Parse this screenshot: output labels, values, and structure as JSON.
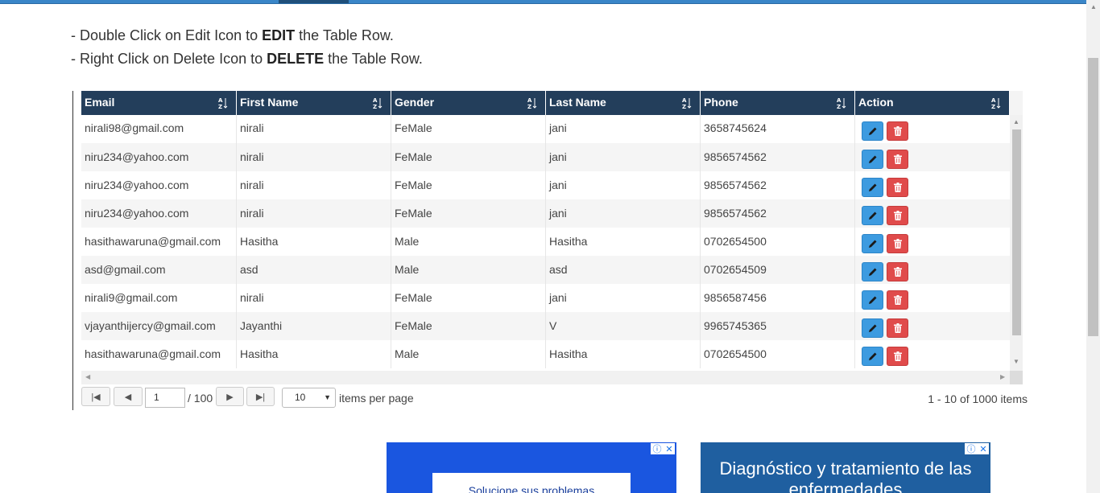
{
  "instructions": {
    "line1_pre": "- Double Click on Edit Icon to ",
    "line1_bold": "EDIT",
    "line1_post": " the Table Row.",
    "line2_pre": "- Right Click on Delete Icon to ",
    "line2_bold": "DELETE",
    "line2_post": " the Table Row."
  },
  "grid": {
    "columns": [
      "Email",
      "First Name",
      "Gender",
      "Last Name",
      "Phone",
      "Action"
    ],
    "rows": [
      {
        "email": "nirali98@gmail.com",
        "first": "nirali",
        "gender": "FeMale",
        "last": "jani",
        "phone": "3658745624"
      },
      {
        "email": "niru234@yahoo.com",
        "first": "nirali",
        "gender": "FeMale",
        "last": "jani",
        "phone": "9856574562"
      },
      {
        "email": "niru234@yahoo.com",
        "first": "nirali",
        "gender": "FeMale",
        "last": "jani",
        "phone": "9856574562"
      },
      {
        "email": "niru234@yahoo.com",
        "first": "nirali",
        "gender": "FeMale",
        "last": "jani",
        "phone": "9856574562"
      },
      {
        "email": "hasithawaruna@gmail.com",
        "first": "Hasitha",
        "gender": "Male",
        "last": "Hasitha",
        "phone": "0702654500"
      },
      {
        "email": "asd@gmail.com",
        "first": "asd",
        "gender": "Male",
        "last": "asd",
        "phone": "0702654509"
      },
      {
        "email": "nirali9@gmail.com",
        "first": "nirali",
        "gender": "FeMale",
        "last": "jani",
        "phone": "9856587456"
      },
      {
        "email": "vjayanthijercy@gmail.com",
        "first": "Jayanthi",
        "gender": "FeMale",
        "last": "V",
        "phone": "9965745365"
      },
      {
        "email": "hasithawaruna@gmail.com",
        "first": "Hasitha",
        "gender": "Male",
        "last": "Hasitha",
        "phone": "0702654500"
      }
    ],
    "icons": {
      "sort": "sort-alpha-icon",
      "edit": "pencil-icon",
      "delete": "trash-icon"
    },
    "colors": {
      "header": "#233e5b",
      "edit": "#3d9be0",
      "delete": "#e04b4b"
    }
  },
  "pager": {
    "current_page": "1",
    "total_pages": "/ 100",
    "page_size": "10",
    "page_size_label": "items per page",
    "info": "1 - 10 of 1000 items"
  },
  "ads": {
    "ad1_text": "Solucione sus problemas",
    "ad2_text": "Diagnóstico y tratamiento de las enfermedades"
  }
}
